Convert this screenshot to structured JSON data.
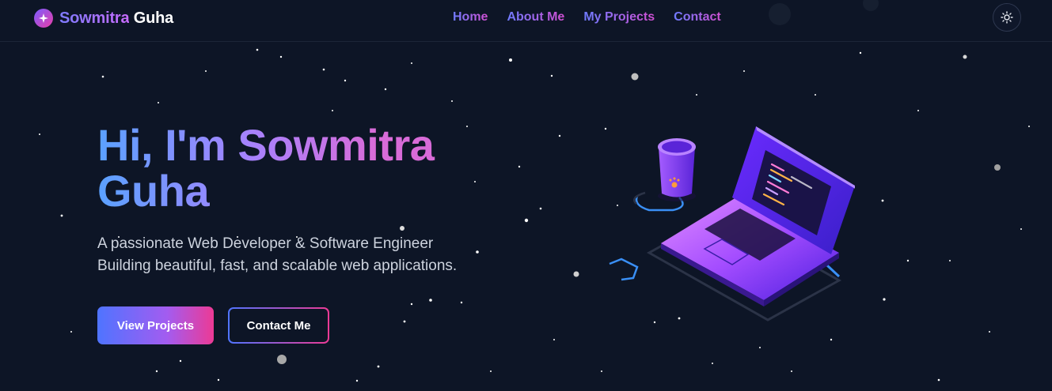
{
  "brand": {
    "first": "Sowmitra",
    "last": "Guha",
    "icon": "sparkle-icon"
  },
  "nav": {
    "items": [
      "Home",
      "About Me",
      "My Projects",
      "Contact"
    ]
  },
  "theme_toggle": {
    "icon": "sun-icon"
  },
  "hero": {
    "title_line1": "Hi, I'm Sowmitra",
    "title_line2": "Guha",
    "subtitle_line1": "A passionate Web Developer & Software Engineer",
    "subtitle_line2": "Building beautiful, fast, and scalable web applications."
  },
  "buttons": {
    "primary": "View Projects",
    "secondary": "Contact Me"
  },
  "illustration": {
    "name": "laptop-and-cup-illustration"
  },
  "colors": {
    "background": "#0d1526",
    "accent_blue": "#4f74ff",
    "accent_purple": "#a35cf0",
    "accent_pink": "#ec3a95"
  }
}
